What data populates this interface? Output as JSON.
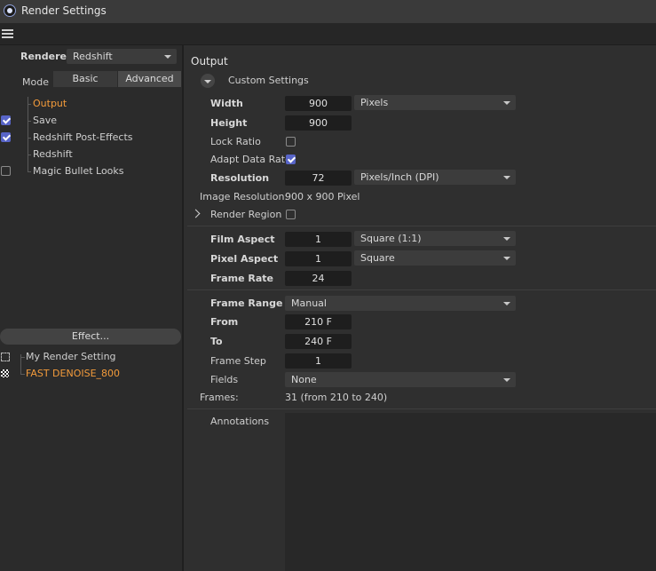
{
  "window": {
    "title": "Render Settings"
  },
  "left": {
    "renderer_label": "Renderer",
    "renderer_value": "Redshift",
    "mode_label": "Mode",
    "mode_basic": "Basic",
    "mode_advanced": "Advanced",
    "tree": [
      {
        "label": "Output",
        "checked": null,
        "selected": true
      },
      {
        "label": "Save",
        "checked": true
      },
      {
        "label": "Redshift Post-Effects",
        "checked": true
      },
      {
        "label": "Redshift",
        "checked": null
      },
      {
        "label": "Magic Bullet Looks",
        "checked": false
      }
    ],
    "effect_button": "Effect...",
    "settings_list": [
      {
        "label": "My Render Setting"
      },
      {
        "label": "FAST DENOISE_800",
        "active": true
      }
    ]
  },
  "output": {
    "section_title": "Output",
    "preset": "Custom Settings",
    "width_label": "Width",
    "width_value": "900",
    "width_unit": "Pixels",
    "height_label": "Height",
    "height_value": "900",
    "lock_ratio_label": "Lock Ratio",
    "lock_ratio": false,
    "adapt_data_rate_label": "Adapt Data Rate",
    "adapt_data_rate": true,
    "resolution_label": "Resolution",
    "resolution_value": "72",
    "resolution_unit": "Pixels/Inch (DPI)",
    "image_resolution_label": "Image Resolution:",
    "image_resolution_value": "900 x 900 Pixel",
    "render_region_label": "Render Region",
    "render_region": false,
    "film_aspect_label": "Film Aspect",
    "film_aspect_value": "1",
    "film_aspect_preset": "Square (1:1)",
    "pixel_aspect_label": "Pixel Aspect",
    "pixel_aspect_value": "1",
    "pixel_aspect_preset": "Square",
    "frame_rate_label": "Frame Rate",
    "frame_rate_value": "24",
    "frame_range_label": "Frame Range",
    "frame_range_value": "Manual",
    "from_label": "From",
    "from_value": "210 F",
    "to_label": "To",
    "to_value": "240 F",
    "frame_step_label": "Frame Step",
    "frame_step_value": "1",
    "fields_label": "Fields",
    "fields_value": "None",
    "frames_label": "Frames:",
    "frames_value": "31 (from 210 to 240)",
    "annotations_label": "Annotations"
  }
}
